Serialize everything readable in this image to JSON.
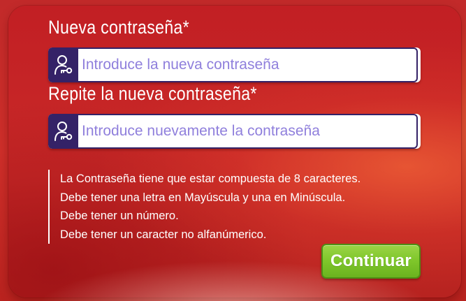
{
  "form": {
    "new_password": {
      "label": "Nueva contraseña*",
      "placeholder": "Introduce la nueva contraseña",
      "value": "",
      "icon": "user-key-icon"
    },
    "repeat_password": {
      "label": "Repite la nueva contraseña*",
      "placeholder": "Introduce nuevamente la contraseña",
      "value": "",
      "icon": "user-key-icon"
    },
    "rules": [
      "La Contraseña tiene que estar compuesta de 8 caracteres.",
      "Debe tener una letra en Mayúscula y una en Minúscula.",
      "Debe tener un número.",
      "Debe tener un caracter no alfanúmerico."
    ],
    "submit_label": "Continuar"
  },
  "colors": {
    "background_red": "#c92a28",
    "field_icon_bg": "#342267",
    "placeholder": "#8f7fdc",
    "button_green": "#7ec62a",
    "text": "#ffffff"
  }
}
